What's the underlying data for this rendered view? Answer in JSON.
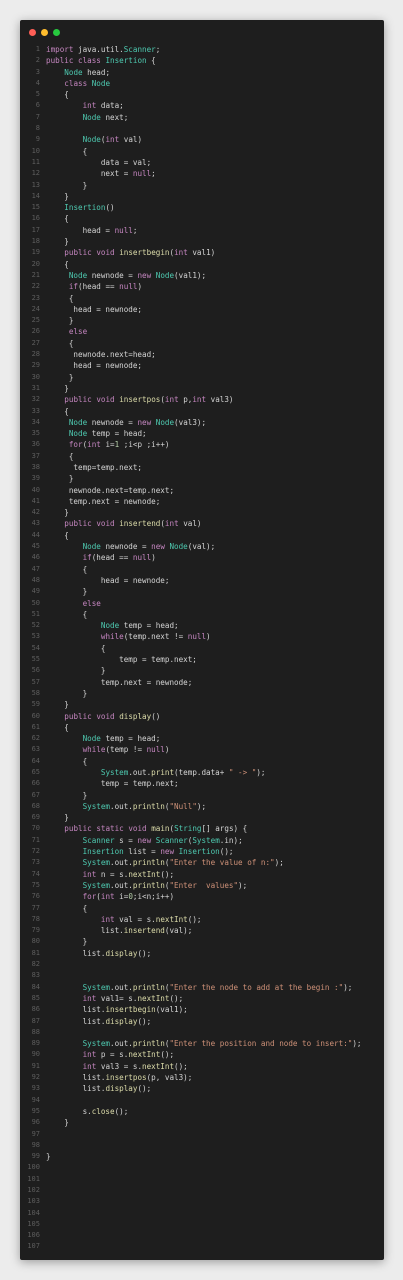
{
  "window": {
    "controls": [
      "close",
      "minimize",
      "maximize"
    ],
    "colors": {
      "background": "#1e1e1e",
      "close": "#ff5f56",
      "minimize": "#ffbd2e",
      "maximize": "#27c93f"
    }
  },
  "code_lines": [
    "import java.util.Scanner;",
    "public class Insertion {",
    "    Node head;",
    "    class Node",
    "    {",
    "        int data;",
    "        Node next;",
    "",
    "        Node(int val)",
    "        {",
    "            data = val;",
    "            next = null;",
    "        }",
    "    }",
    "    Insertion()",
    "    {",
    "        head = null;",
    "    }",
    "    public void insertbegin(int val1)",
    "    {",
    "     Node newnode = new Node(val1);",
    "     if(head == null)",
    "     {",
    "      head = newnode;",
    "     }",
    "     else",
    "     {",
    "      newnode.next=head;",
    "      head = newnode;",
    "     }",
    "    }",
    "    public void insertpos(int p,int val3)",
    "    {",
    "     Node newnode = new Node(val3);",
    "     Node temp = head;",
    "     for(int i=1 ;i<p ;i++)",
    "     {",
    "      temp=temp.next;",
    "     }",
    "     newnode.next=temp.next;",
    "     temp.next = newnode;",
    "    }",
    "    public void insertend(int val)",
    "    {",
    "        Node newnode = new Node(val);",
    "        if(head == null)",
    "        {",
    "            head = newnode;",
    "        }",
    "        else",
    "        {",
    "            Node temp = head;",
    "            while(temp.next != null)",
    "            {",
    "                temp = temp.next;",
    "            }",
    "            temp.next = newnode;",
    "        }",
    "    }",
    "    public void display()",
    "    {",
    "        Node temp = head;",
    "        while(temp != null)",
    "        {",
    "            System.out.print(temp.data+ \" -> \");",
    "            temp = temp.next;",
    "        }",
    "        System.out.println(\"Null\");",
    "    }",
    "    public static void main(String[] args) {",
    "        Scanner s = new Scanner(System.in);",
    "        Insertion list = new Insertion();",
    "        System.out.println(\"Enter the value of n:\");",
    "        int n = s.nextInt();",
    "        System.out.println(\"Enter  values\");",
    "        for(int i=0;i<n;i++)",
    "        {",
    "            int val = s.nextInt();",
    "            list.insertend(val);",
    "        }",
    "        list.display();",
    "",
    "",
    "        System.out.println(\"Enter the node to add at the begin :\");",
    "        int val1= s.nextInt();",
    "        list.insertbegin(val1);",
    "        list.display();",
    "",
    "        System.out.println(\"Enter the position and node to insert:\");",
    "        int p = s.nextInt();",
    "        int val3 = s.nextInt();",
    "        list.insertpos(p, val3);",
    "        list.display();",
    "",
    "        s.close();",
    "    }",
    "",
    "",
    "}",
    "",
    "",
    "",
    "",
    "",
    "",
    "",
    ""
  ]
}
